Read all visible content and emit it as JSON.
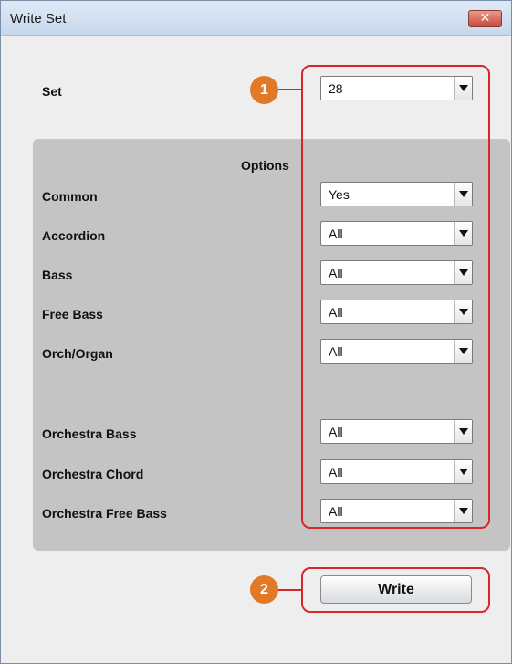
{
  "window": {
    "title": "Write Set",
    "close_glyph": "✕"
  },
  "set": {
    "label": "Set",
    "value": "28"
  },
  "options": {
    "title": "Options",
    "rows": [
      {
        "label": "Common",
        "value": "Yes"
      },
      {
        "label": "Accordion",
        "value": "All"
      },
      {
        "label": "Bass",
        "value": "All"
      },
      {
        "label": "Free Bass",
        "value": "All"
      },
      {
        "label": "Orch/Organ",
        "value": "All"
      },
      {
        "label": "Orchestra Bass",
        "value": "All"
      },
      {
        "label": "Orchestra Chord",
        "value": "All"
      },
      {
        "label": "Orchestra Free Bass",
        "value": "All"
      }
    ]
  },
  "write_button": {
    "label": "Write"
  },
  "callouts": {
    "one": "1",
    "two": "2"
  },
  "colors": {
    "callout_red": "#d9262d",
    "callout_badge": "#e07a28",
    "panel_gray": "#c4c4c4"
  }
}
